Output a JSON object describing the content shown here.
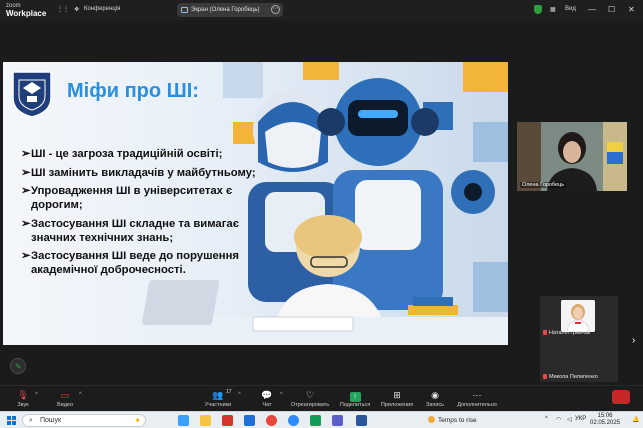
{
  "titlebar": {
    "brand_line1": "zoom",
    "brand_line2": "Workplace",
    "conference_label": "Конференція",
    "screen_share_label": "Экран (Олена Горобець)",
    "view_label": "Вид"
  },
  "slide": {
    "title": "Міфи про ШІ:",
    "myths": [
      "ШІ - це загроза традиційній освіті;",
      "ШІ замінить викладачів у майбутньому;",
      "Упровадження ШІ в університетах є дорогим;",
      "Застосування ШІ складне та вимагає значних технічних знань;",
      "Застосування ШІ веде до порушення академічної доброчесності."
    ],
    "bullet": "➢"
  },
  "participants_panel": {
    "main_tile_name": "Олена Горобець",
    "mini_tiles": [
      {
        "name": "Наталія Гривчак"
      },
      {
        "name": "Микола Пилипенко"
      }
    ]
  },
  "toolbar": {
    "items": [
      {
        "label": "Звук",
        "icon": "mic-muted-icon"
      },
      {
        "label": "Видео",
        "icon": "video-off-icon"
      },
      {
        "label": "Участники",
        "icon": "participants-icon",
        "count": "17"
      },
      {
        "label": "Чат",
        "icon": "chat-icon"
      },
      {
        "label": "Отреагировать",
        "icon": "heart-icon"
      },
      {
        "label": "Поделиться",
        "icon": "share-icon"
      },
      {
        "label": "Приложения",
        "icon": "apps-icon"
      },
      {
        "label": "Запись",
        "icon": "record-icon"
      },
      {
        "label": "Дополнительно",
        "icon": "more-icon"
      }
    ]
  },
  "taskbar": {
    "search_placeholder": "Пошук",
    "weather_text": "Temps to rise",
    "language": "УКР",
    "time": "15:06",
    "date": "02.05.2025"
  },
  "colors": {
    "accent_blue": "#2a8fe0",
    "share_green": "#22a55a",
    "end_red": "#c62828"
  }
}
